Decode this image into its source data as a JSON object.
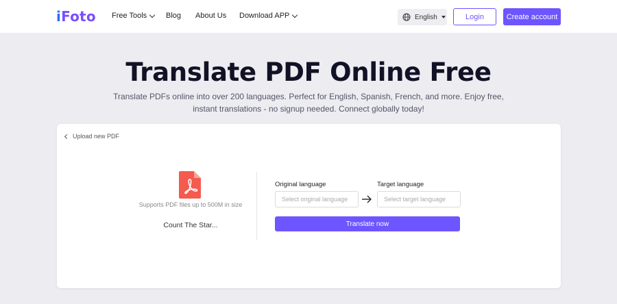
{
  "header": {
    "logo_i": "i",
    "logo_rest": "Foto",
    "nav": [
      {
        "label": "Free Tools",
        "has_dropdown": true
      },
      {
        "label": "Blog",
        "has_dropdown": false
      },
      {
        "label": "About Us",
        "has_dropdown": false
      },
      {
        "label": "Download APP",
        "has_dropdown": true
      }
    ],
    "language": "English",
    "login_label": "Login",
    "create_account_label": "Create account"
  },
  "hero": {
    "title": "Translate PDF Online Free",
    "subtitle": "Translate PDFs online into over 200 languages. Perfect for English, Spanish, French, and more. Enjoy free, instant translations - no signup needed. Connect globally today!"
  },
  "card": {
    "upload_new_label": "Upload new PDF",
    "support_text": "Supports PDF files up to 500M in size",
    "file_name": "Count The Star...",
    "original_language_label": "Original language",
    "original_language_placeholder": "Select original language",
    "target_language_label": "Target language",
    "target_language_placeholder": "Select target language",
    "translate_label": "Translate now"
  },
  "colors": {
    "accent": "#6d55ff",
    "pdf_icon": "#f45a4e",
    "page_bg": "#ececf1"
  },
  "icons": [
    "globe-icon",
    "caret-down-icon",
    "chevron-left-icon",
    "pdf-file-icon",
    "arrow-right-icon",
    "chevron-down-icon"
  ]
}
